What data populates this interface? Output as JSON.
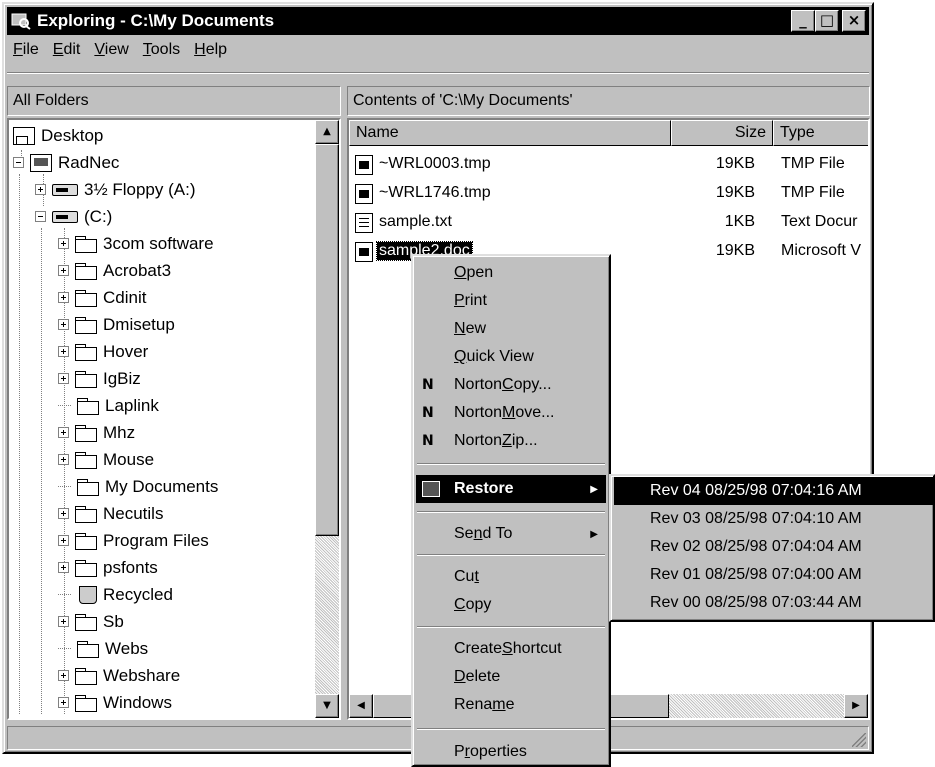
{
  "window": {
    "title": "Exploring - C:\\My Documents",
    "minimize": "_",
    "maximize": "□",
    "close": "×"
  },
  "menubar": [
    {
      "pre": "",
      "key": "F",
      "post": "ile"
    },
    {
      "pre": "",
      "key": "E",
      "post": "dit"
    },
    {
      "pre": "",
      "key": "V",
      "post": "iew"
    },
    {
      "pre": "",
      "key": "T",
      "post": "ools"
    },
    {
      "pre": "",
      "key": "H",
      "post": "elp"
    }
  ],
  "left_pane": {
    "header": "All Folders",
    "tree": [
      {
        "label": "Desktop",
        "icon": "desktop-icon"
      },
      {
        "label": "RadNec",
        "icon": "computer-icon"
      },
      {
        "label": "3½ Floppy (A:)",
        "icon": "floppy-drive-icon"
      },
      {
        "label": "(C:)",
        "icon": "hard-drive-icon"
      },
      {
        "label": "3com software",
        "icon": "folder-icon"
      },
      {
        "label": "Acrobat3",
        "icon": "folder-icon"
      },
      {
        "label": "Cdinit",
        "icon": "folder-icon"
      },
      {
        "label": "Dmisetup",
        "icon": "folder-icon"
      },
      {
        "label": "Hover",
        "icon": "folder-icon"
      },
      {
        "label": "IgBiz",
        "icon": "folder-icon"
      },
      {
        "label": "Laplink",
        "icon": "folder-icon"
      },
      {
        "label": "Mhz",
        "icon": "folder-icon"
      },
      {
        "label": "Mouse",
        "icon": "folder-icon"
      },
      {
        "label": "My Documents",
        "icon": "open-folder-icon"
      },
      {
        "label": "Necutils",
        "icon": "folder-icon"
      },
      {
        "label": "Program Files",
        "icon": "folder-icon"
      },
      {
        "label": "psfonts",
        "icon": "folder-icon"
      },
      {
        "label": "Recycled",
        "icon": "recycle-bin-icon"
      },
      {
        "label": "Sb",
        "icon": "folder-icon"
      },
      {
        "label": "Webs",
        "icon": "folder-icon"
      },
      {
        "label": "Webshare",
        "icon": "folder-icon"
      },
      {
        "label": "Windows",
        "icon": "folder-icon"
      }
    ]
  },
  "right_pane": {
    "header": "Contents of 'C:\\My Documents'",
    "columns": {
      "name": "Name",
      "size": "Size",
      "type": "Type"
    },
    "files": [
      {
        "name": "~WRL0003.tmp",
        "size": "19KB",
        "type": "TMP File",
        "icon": "tmp-file-icon"
      },
      {
        "name": "~WRL1746.tmp",
        "size": "19KB",
        "type": "TMP File",
        "icon": "tmp-file-icon"
      },
      {
        "name": "sample.txt",
        "size": "1KB",
        "type": "Text Docur",
        "icon": "text-file-icon"
      },
      {
        "name": "sample2.doc",
        "size": "19KB",
        "type": "Microsoft V",
        "icon": "word-doc-icon"
      }
    ]
  },
  "context_menu": {
    "open": {
      "pre": "",
      "key": "O",
      "post": "pen"
    },
    "print": {
      "pre": "",
      "key": "P",
      "post": "rint"
    },
    "new": {
      "pre": "",
      "key": "N",
      "post": "ew"
    },
    "quick_view": {
      "pre": "",
      "key": "Q",
      "post": "uick View"
    },
    "norton_copy": {
      "pre": "Norton ",
      "key": "C",
      "post": "opy..."
    },
    "norton_move": {
      "pre": "Norton ",
      "key": "M",
      "post": "ove..."
    },
    "norton_zip": {
      "pre": "Norton ",
      "key": "Z",
      "post": "ip..."
    },
    "restore": "Restore",
    "send_to": {
      "pre": "Se",
      "key": "n",
      "post": "d To"
    },
    "cut": {
      "pre": "Cu",
      "key": "t",
      "post": ""
    },
    "copy": {
      "pre": "",
      "key": "C",
      "post": "opy"
    },
    "create_shortcut": {
      "pre": "Create ",
      "key": "S",
      "post": "hortcut"
    },
    "delete": {
      "pre": "",
      "key": "D",
      "post": "elete"
    },
    "rename": {
      "pre": "Rena",
      "key": "m",
      "post": "e"
    },
    "properties": {
      "pre": "P",
      "key": "r",
      "post": "operties"
    },
    "norton_glyph": "N"
  },
  "restore_submenu": [
    "Rev 04  08/25/98 07:04:16 AM",
    "Rev 03  08/25/98 07:04:10 AM",
    "Rev 02  08/25/98 07:04:04 AM",
    "Rev 01  08/25/98 07:04:00 AM",
    "Rev 00  08/25/98 07:03:44 AM"
  ]
}
